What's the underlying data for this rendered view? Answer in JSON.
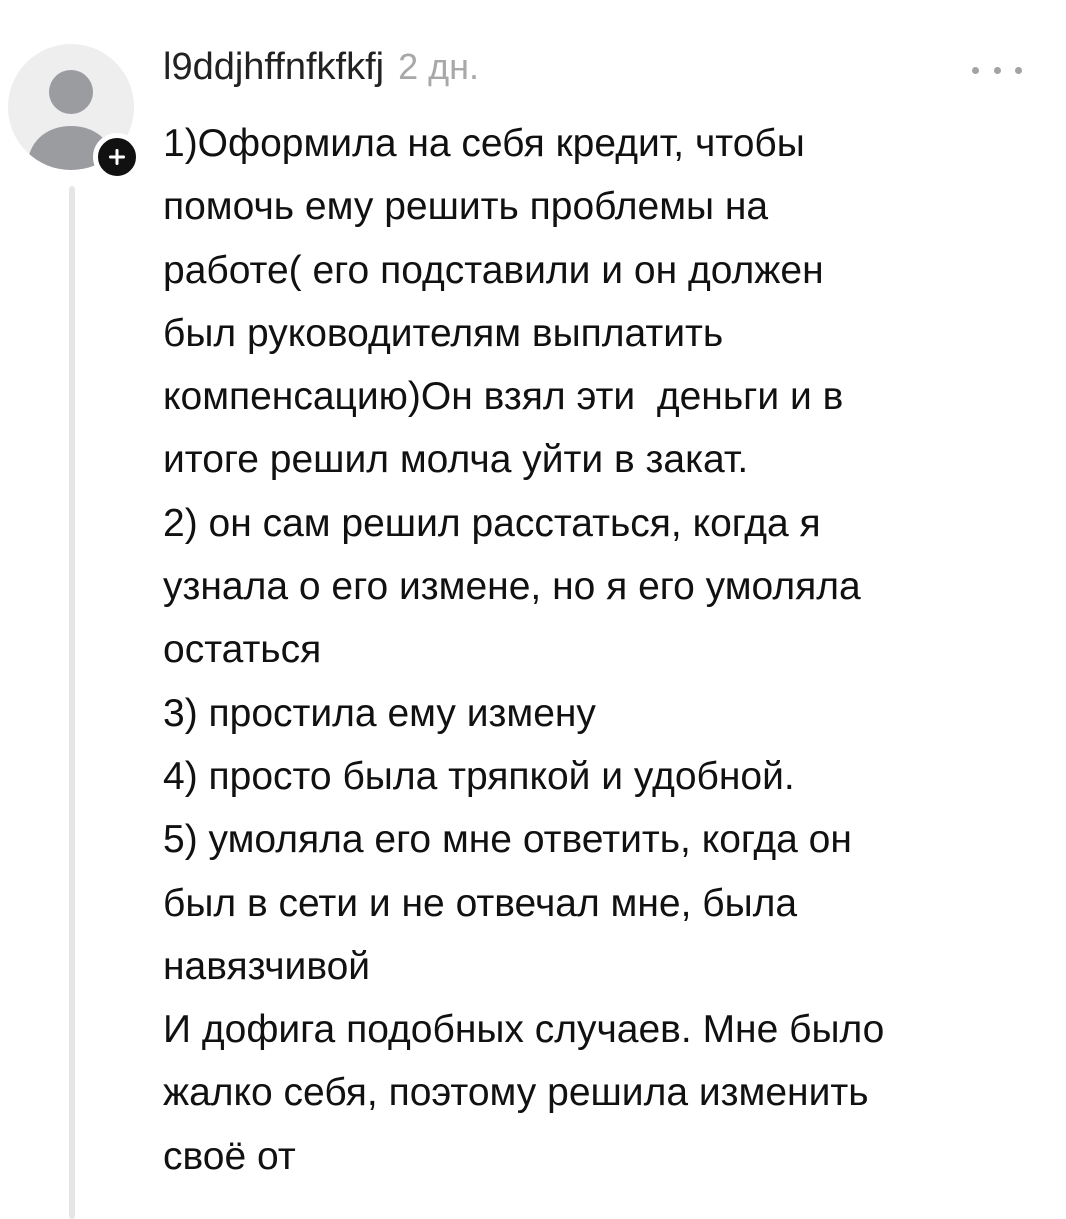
{
  "comment": {
    "author": "l9ddjhffnfkfkfj",
    "timestamp": "2 дн.",
    "more_icon": "more-horizontal-icon",
    "follow_icon": "plus-icon",
    "avatar_icon": "default-user-avatar-icon",
    "lines": [
      "1)Оформила на себя кредит, чтобы",
      "помочь ему решить проблемы на",
      "работе( его подставили и он должен",
      "был руководителям выплатить",
      "компенсацию)Он взял эти  деньги и в",
      "итоге решил молча уйти в закат.",
      "2) он сам решил расстаться, когда я",
      "узнала о его измене, но я его умоляла",
      "остаться",
      "3) простила ему измену",
      "4) просто была тряпкой и удобной.",
      "5) умоляла его мне ответить, когда он",
      "был в сети и не отвечал мне, была",
      "навязчивой",
      "И дофига подобных случаев. Мне было",
      "жалко себя, поэтому решила изменить",
      "своё от"
    ]
  },
  "colors": {
    "avatar_bg": "#eeeeef",
    "avatar_figure": "#9a9ca0",
    "badge_bg": "#111111",
    "thread_line": "#e6e6e6",
    "meta_text": "#a8a8a8",
    "body_text": "#111111"
  }
}
